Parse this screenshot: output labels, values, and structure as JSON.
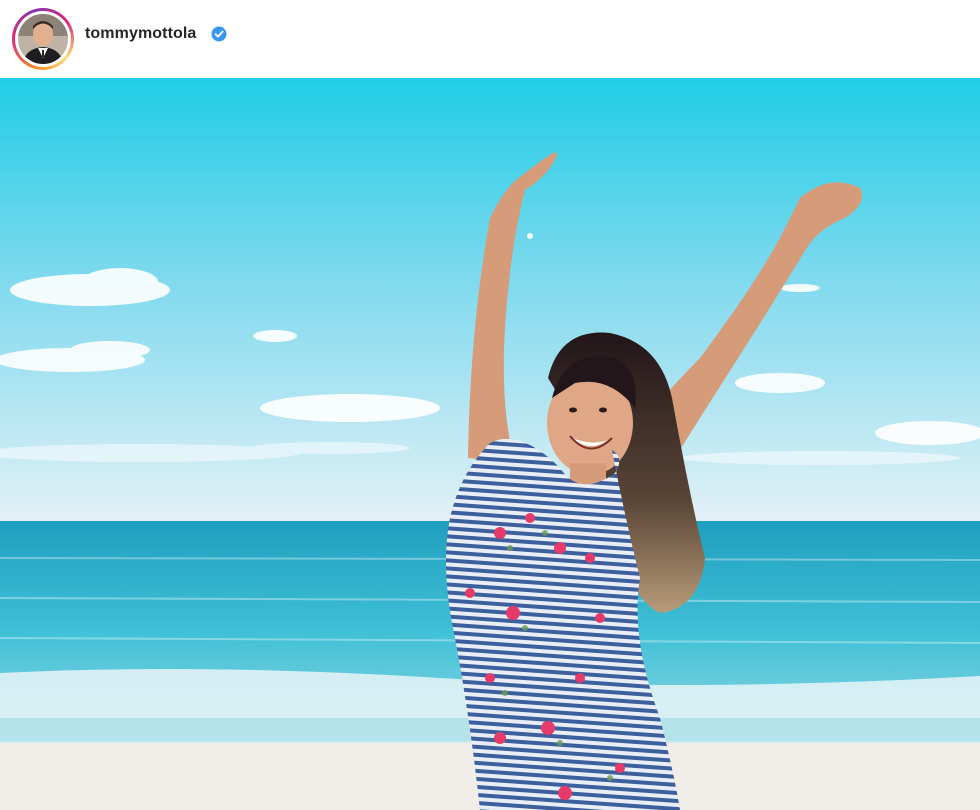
{
  "post": {
    "username": "tommymottola",
    "verified": true,
    "avatar_icon": "profile-photo",
    "verified_icon": "verified-badge-icon",
    "verified_color": "#3897f0"
  },
  "photo": {
    "colors": {
      "sky_top": "#1fcde6",
      "sky_bottom": "#e3f1f6",
      "sea": "#33b2cd",
      "sand": "#f1eeea",
      "dress_stripe": "#3d5f9e",
      "flower": "#e63a6b"
    }
  }
}
